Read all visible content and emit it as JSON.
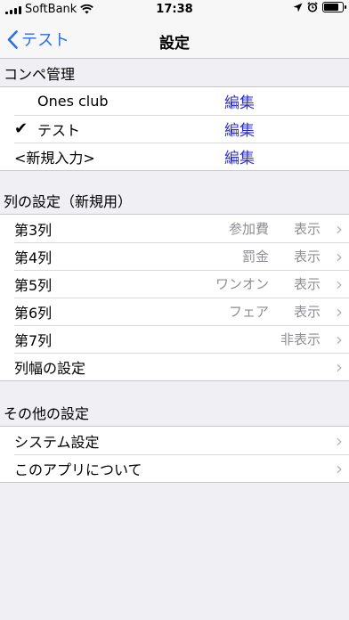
{
  "status_bar": {
    "carrier": "SoftBank",
    "time": "17:38"
  },
  "nav": {
    "back_label": "テスト",
    "title": "設定"
  },
  "compe": {
    "header": "コンペ管理",
    "rows": [
      {
        "name": "Ones club",
        "checked": false,
        "edit_label": "編集"
      },
      {
        "name": "テスト",
        "checked": true,
        "edit_label": "編集"
      },
      {
        "name": "<新規入力>",
        "checked": false,
        "edit_label": "編集"
      }
    ],
    "check_mark": "✔"
  },
  "columns": {
    "header": "列の設定（新規用）",
    "rows": [
      {
        "label": "第3列",
        "value": "参加費",
        "display": "表示"
      },
      {
        "label": "第4列",
        "value": "罰金",
        "display": "表示"
      },
      {
        "label": "第5列",
        "value": "ワンオン",
        "display": "表示"
      },
      {
        "label": "第6列",
        "value": "フェア",
        "display": "表示"
      },
      {
        "label": "第7列",
        "value": "",
        "display": "非表示"
      },
      {
        "label": "列幅の設定",
        "value": "",
        "display": ""
      }
    ]
  },
  "other": {
    "header": "その他の設定",
    "rows": [
      {
        "label": "システム設定"
      },
      {
        "label": "このアプリについて"
      }
    ]
  },
  "icons": {
    "chevron": "›"
  }
}
